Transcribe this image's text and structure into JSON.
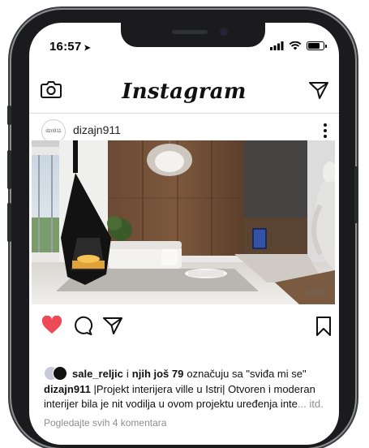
{
  "status_bar": {
    "time": "16:57",
    "location_glyph": "➤",
    "battery_level": 0.85
  },
  "app": {
    "name": "Instagram"
  },
  "header": {
    "icons": [
      "camera-icon",
      "direct-message-icon"
    ]
  },
  "post": {
    "avatar_text": "dzn911",
    "username": "dizajn911",
    "image_watermark": "dzn911",
    "liked": true,
    "colors": {
      "like": "#ed4956",
      "muted": "#8e8e8e",
      "text": "#111111"
    },
    "likes": {
      "first_user": "sale_reljic",
      "connector": "i",
      "others": "njih još 79",
      "suffix": "označuju sa \"sviđa mi se\""
    },
    "caption": {
      "username": "dizajn911",
      "text": "|Projekt interijera ville u Istri| Otvoren i moderan interijer bila je nit vodilja u ovom projektu uređenja inte",
      "more": "... itd."
    },
    "comments_link": "Pogledajte svih 4 komentara"
  }
}
